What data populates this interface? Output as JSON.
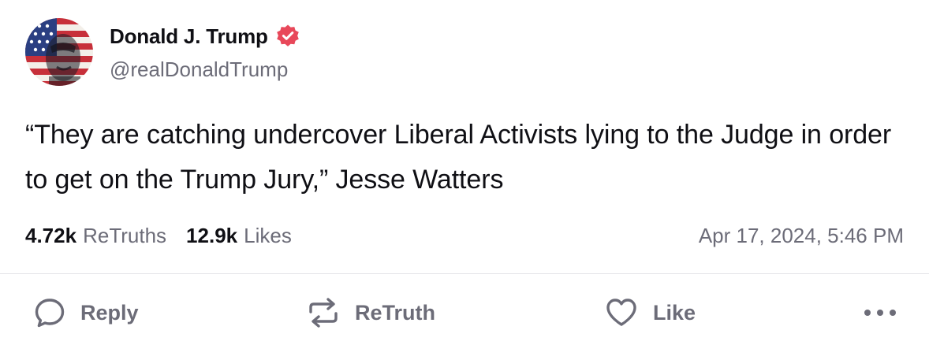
{
  "author": {
    "display_name": "Donald J. Trump",
    "handle": "@realDonaldTrump",
    "verified": true,
    "avatar_icon": "flag-portrait-avatar"
  },
  "post": {
    "text": "“They are catching undercover Liberal Activists lying to the Judge in order to get on the Trump Jury,” Jesse Watters",
    "timestamp": "Apr 17, 2024, 5:46 PM"
  },
  "stats": {
    "retruths_count": "4.72k",
    "retruths_label": "ReTruths",
    "likes_count": "12.9k",
    "likes_label": "Likes"
  },
  "actions": {
    "reply_label": "Reply",
    "retruth_label": "ReTruth",
    "like_label": "Like"
  },
  "icons": {
    "reply": "speech-bubble-icon",
    "retruth": "repost-arrows-icon",
    "like": "heart-icon",
    "more": "ellipsis-icon",
    "verified": "verified-badge-icon"
  },
  "colors": {
    "verified_badge": "#e8485a",
    "text_primary": "#0f0f14",
    "text_secondary": "#6c6c78",
    "divider": "#e4e4e8"
  }
}
